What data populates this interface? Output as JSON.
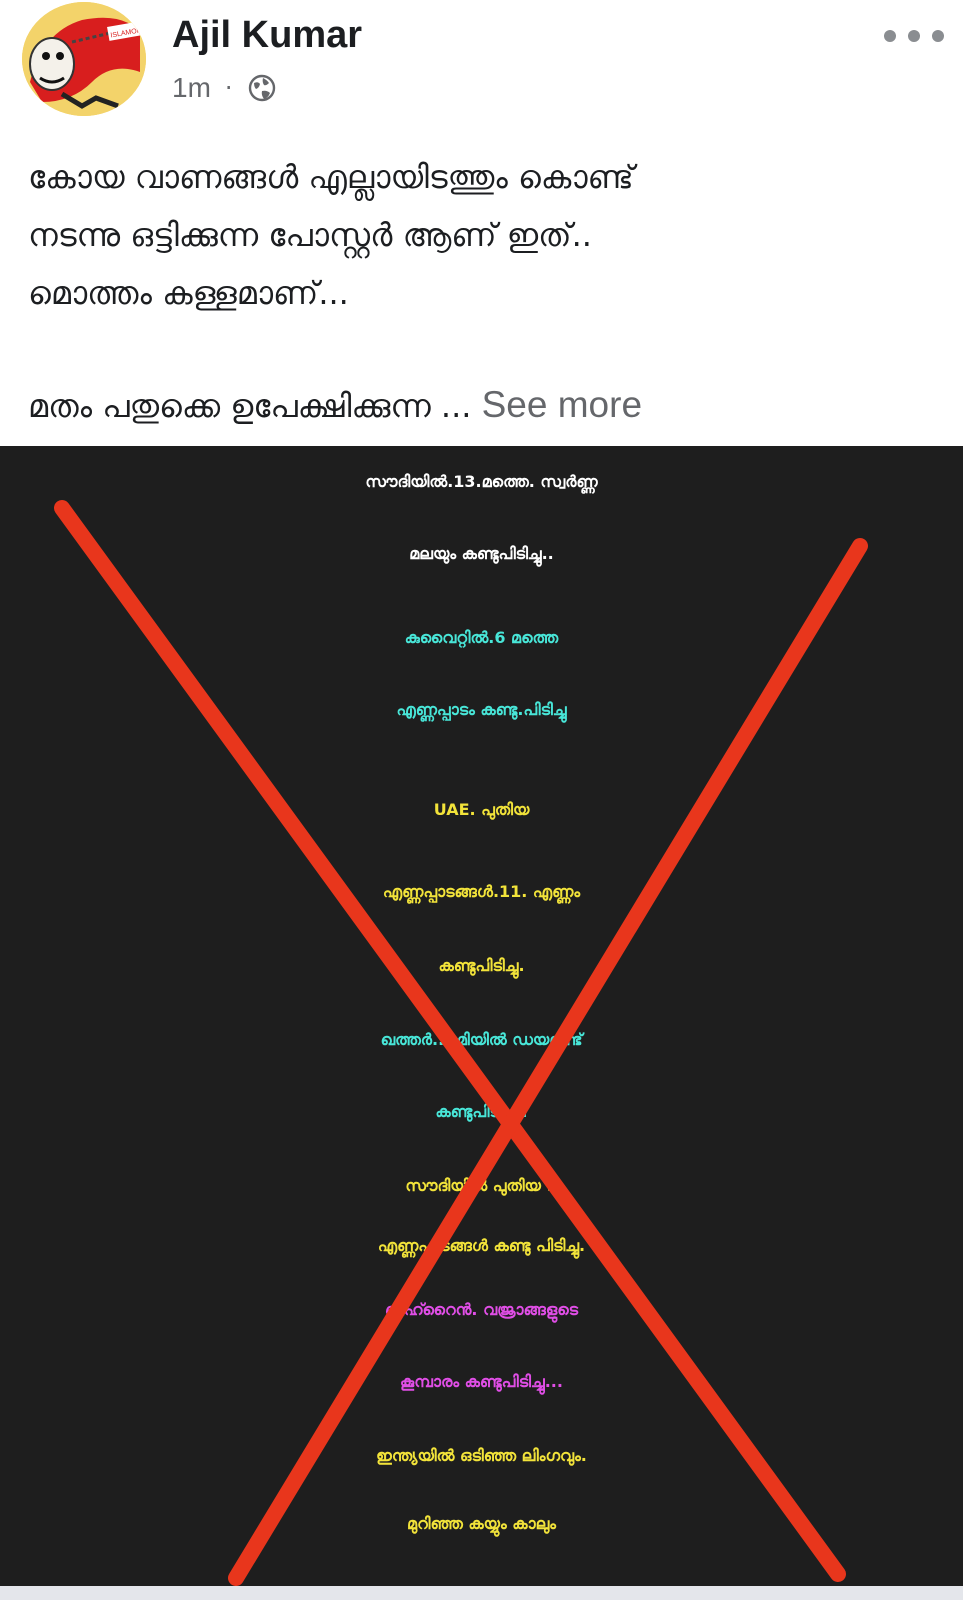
{
  "post": {
    "author": "Ajil Kumar",
    "time": "1m",
    "separator": "·",
    "privacy_icon": "globe-icon",
    "more_icon": "more-horizontal-icon",
    "avatar_label": "ISLAMONK",
    "text_lines": [
      "കോയ വാണങ്ങൾ എല്ലായിടത്തും കൊണ്ട്",
      "നടന്നു ഒട്ടിക്കുന്ന പോസ്റ്റർ ആണ് ഇത്..",
      "മൊത്തം കള്ളമാണ്..."
    ],
    "truncated_line": "മതം പതുക്കെ ഉപേക്ഷിക്കുന്ന ...",
    "see_more": "See more"
  },
  "poster": {
    "lines": [
      "സൗദിയിൽ.13.മത്തെ. സ്വർണ്ണ",
      "മലയും കണ്ടുപിടിച്ചു..",
      "കുവൈറ്റിൽ.6 മത്തെ",
      "എണ്ണപ്പാടം കണ്ടു.പിടിച്ചു",
      "UAE. പുതിയ",
      "എണ്ണപ്പാടങ്ങൾ.11. എണ്ണം",
      "കണ്ടുപിടിച്ചു.",
      "ഖത്തർ..ഭൂമിയിൽ ഡയമണ്ട്",
      "കണ്ടുപിടിച്ചു..",
      "സൗദിയിൽ പുതിയ 9",
      "എണ്ണപാടങ്ങൾ കണ്ടു പിടിച്ചു.",
      "ബഹ്റൈൻ. വജ്രാങ്ങളുടെ",
      "കൂമ്പാരം കണ്ടുപിടിച്ചു...",
      "ഇന്ത്യയിൽ ഒടിഞ്ഞ ലിംഗവും.",
      "മുറിഞ്ഞ കയ്യും കാലും"
    ],
    "cross_color": "#e8361c",
    "colors": {
      "white": "#ffffff",
      "cyan": "#48e6d8",
      "yellow": "#f2e33a",
      "magenta": "#e04ee6",
      "background": "#1e1e1e"
    }
  }
}
